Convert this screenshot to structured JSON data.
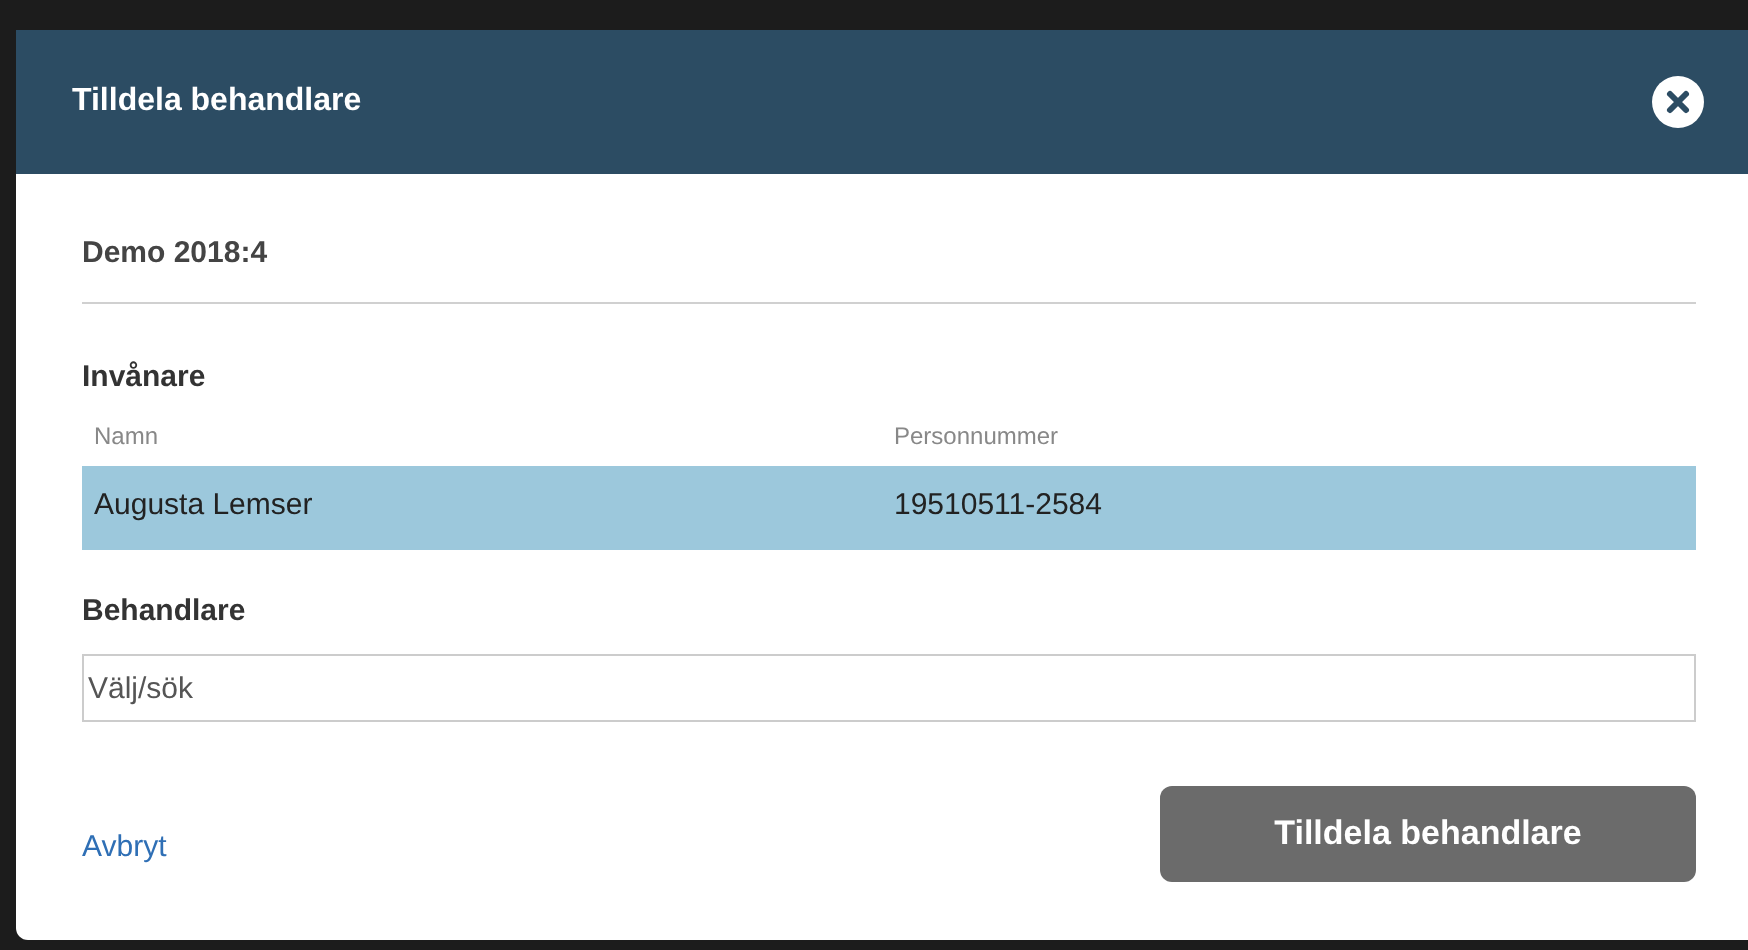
{
  "dialog": {
    "title": "Tilldela behandlare",
    "subtitle": "Demo 2018:4"
  },
  "residents": {
    "heading": "Invånare",
    "columns": [
      "Namn",
      "Personnummer"
    ],
    "rows": [
      {
        "cells": [
          "Augusta Lemser",
          "19510511-2584"
        ],
        "selected": true
      }
    ]
  },
  "handler": {
    "label": "Behandlare",
    "placeholder": "Välj/sök"
  },
  "cancel_link": "Avbryt",
  "submit_button": {
    "label": "Tilldela behandlare",
    "disabled": true
  }
}
